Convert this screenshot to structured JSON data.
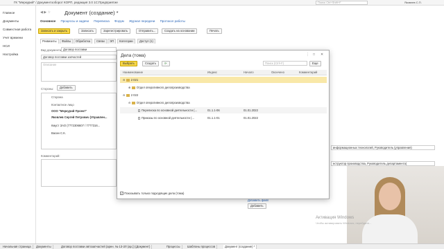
{
  "titlebar": {
    "title": "ГК \"Меркурий\" / Документооборот КОРП, редакция 3.0 1С:Предприятие",
    "search_placeholder": "Поиск Ctrl+Shift+F",
    "user": "Яковлев С.П."
  },
  "sidebar": {
    "items": [
      "Главное",
      "Документы",
      "Совместная работа",
      "Учет времени",
      "НСИ",
      "Настройка"
    ]
  },
  "document": {
    "title": "Документ (создание) *",
    "links": {
      "main": "Основное",
      "processes": "Процессы и задачи",
      "correspondence": "Переписка",
      "forum": "Форум",
      "journal": "Журнал передачи",
      "protocol": "Протокол работы"
    },
    "toolbar": {
      "save_close": "Записать и закрыть",
      "save": "Записать",
      "register": "Зарегистрировать",
      "send": "Отправить...",
      "create_based": "Создать на основании",
      "print": "Печать"
    },
    "tabs": [
      "Реквизиты",
      "Файлы",
      "Обработка",
      "Связи",
      "ЭП",
      "Категории",
      "Доступ (1)"
    ],
    "doc_type_label": "Вид документа:",
    "doc_type_value": "Договор поставки",
    "subject": "Договор поставки запчастей",
    "description_placeholder": "Описание",
    "parties_label": "Стороны:",
    "add_button": "Добавить",
    "parties": {
      "col_side": "Сторона",
      "col_contact": "Контактное лицо",
      "rows": [
        "ООО \"Меркурий Проект\"",
        "Яковлев Сергей Петрович (Управлен...",
        "Кмуст ЗАО (7772306607 / 7777316...",
        "Васин С.К."
      ]
    },
    "comment_label": "Комментарий:",
    "add_file": "Добавить файл",
    "add_file_button": "Добавить",
    "right_fields": [
      "информационных технологий, Руководитель (управления)",
      "нструктор производства, Руководитель департамента)"
    ]
  },
  "dialog": {
    "title": "Дела (тома)",
    "select_button": "Выбрать",
    "create_button": "Создать",
    "search_placeholder": "Поиск (Ctrl+F)",
    "more_button": "Еще",
    "columns": [
      "Наименование",
      "Индекс",
      "Начало",
      "Окончено",
      "Комментарий"
    ],
    "rows": [
      {
        "name": "2 021",
        "index": "",
        "start": "",
        "level": 0,
        "kind": "folder",
        "selected": true
      },
      {
        "name": "Отдел оперативного делопроизводства",
        "index": "",
        "start": "",
        "level": 1,
        "kind": "folder"
      },
      {
        "name": "2 022",
        "index": "",
        "start": "",
        "level": 0,
        "kind": "folder"
      },
      {
        "name": "Отдел оперативного делопроизводства",
        "index": "",
        "start": "",
        "level": 1,
        "kind": "folder"
      },
      {
        "name": "Переписка по основной деятельности (...",
        "index": "01.1.1-06",
        "start": "01.01.2022",
        "level": 2,
        "kind": "doc"
      },
      {
        "name": "Приказы по основной деятельности (...",
        "index": "01.1.1-01",
        "start": "01.01.2022",
        "level": 2,
        "kind": "doc"
      }
    ],
    "checkbox_label": "Показывать только подходящие дела (тома)"
  },
  "taskbar": {
    "items": [
      "Начальная страница",
      "Документы",
      "Договор поставки автозапчастей (арен. № 13-2Л (ар.)) (Документ)",
      "Процессы",
      "Шаблоны процессов",
      "Документ (создание) *"
    ]
  },
  "watermark": {
    "line1": "Активация Windows",
    "line2": "Чтобы активировать Windows, перейдите..."
  }
}
